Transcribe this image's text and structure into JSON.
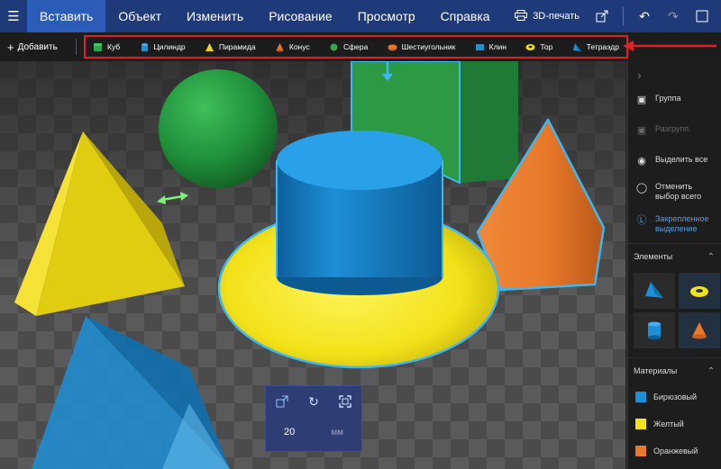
{
  "menubar": {
    "tabs": [
      {
        "label": "Вставить",
        "active": true
      },
      {
        "label": "Объект",
        "active": false
      },
      {
        "label": "Изменить",
        "active": false
      },
      {
        "label": "Рисование",
        "active": false
      },
      {
        "label": "Просмотр",
        "active": false
      },
      {
        "label": "Справка",
        "active": false
      }
    ],
    "print_label": "3D-печать"
  },
  "toolbar": {
    "add_label": "Добавить",
    "shapes": [
      {
        "label": "Куб",
        "icon": "cube-icon",
        "color": "#2ea84a"
      },
      {
        "label": "Цилиндр",
        "icon": "cylinder-icon",
        "color": "#1d8fd6"
      },
      {
        "label": "Пирамида",
        "icon": "pyramid-icon",
        "color": "#e8d21c"
      },
      {
        "label": "Конус",
        "icon": "cone-icon",
        "color": "#e8782a"
      },
      {
        "label": "Сфера",
        "icon": "sphere-icon",
        "color": "#2ea84a"
      },
      {
        "label": "Шестиугольник",
        "icon": "hexagon-icon",
        "color": "#e8782a"
      },
      {
        "label": "Клин",
        "icon": "wedge-icon",
        "color": "#1d8fd6"
      },
      {
        "label": "Тор",
        "icon": "torus-icon",
        "color": "#f2e21a"
      },
      {
        "label": "Тетраэдр",
        "icon": "tetrahedron-icon",
        "color": "#1d8fd6"
      }
    ]
  },
  "size_panel": {
    "value": "20",
    "unit": "мм"
  },
  "rpanel": {
    "actions": [
      {
        "label": "Группа",
        "state": "normal",
        "icon": "group-icon"
      },
      {
        "label": "Разгрупп.",
        "state": "disabled",
        "icon": "ungroup-icon"
      },
      {
        "label": "Выделить все",
        "state": "normal",
        "icon": "select-all-icon"
      },
      {
        "label": "Отменить выбор всего",
        "state": "normal",
        "icon": "deselect-icon"
      },
      {
        "label": "Закрепленное выделение",
        "state": "accent",
        "icon": "pinned-selection-icon"
      }
    ],
    "elements_title": "Элементы",
    "materials_title": "Материалы",
    "materials": [
      {
        "label": "Бирюзовый",
        "color": "#1d8fd6"
      },
      {
        "label": "Желтый",
        "color": "#f2e21a"
      },
      {
        "label": "Оранжевый",
        "color": "#e8782a"
      }
    ]
  },
  "colors": {
    "menubar": "#1f3a78",
    "active_tab": "#2b5cb8",
    "highlight": "#d9232a",
    "selection": "#3fb8f0"
  }
}
